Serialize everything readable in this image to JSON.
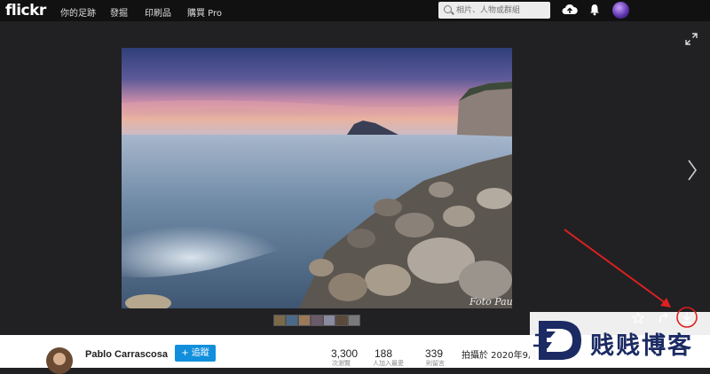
{
  "topbar": {
    "logo": "flickr",
    "nav": [
      "你的足跡",
      "發掘",
      "印刷品",
      "購買 Pro"
    ],
    "search_placeholder": "相片、人物或群組"
  },
  "photo": {
    "signature": "Foto Pau"
  },
  "author": {
    "name": "Pablo Carrascosa",
    "follow_label": "+ 追蹤"
  },
  "stats": [
    {
      "value": "3,300",
      "label": "次瀏覽"
    },
    {
      "value": "188",
      "label": "人加入最愛"
    },
    {
      "value": "339",
      "label": "則留言"
    }
  ],
  "taken": "拍攝於 2020年9月",
  "watermark": {
    "text": "贱贱博客"
  },
  "colors": {
    "accent": "#128fdc",
    "annotation": "#e02020",
    "background": "#212124"
  },
  "icons": [
    "search-icon",
    "upload-cloud-icon",
    "notification-bell-icon",
    "fullscreen-icon",
    "next-arrow-icon",
    "favorite-star-icon",
    "share-icon",
    "download-icon"
  ]
}
